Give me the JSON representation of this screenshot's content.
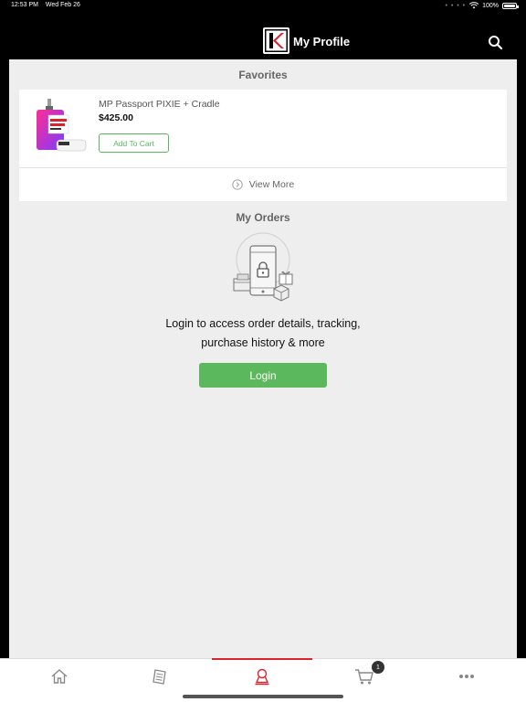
{
  "status_bar": {
    "time": "12:53 PM",
    "date": "Wed Feb 26",
    "battery": "100%"
  },
  "nav": {
    "title": "My Profile",
    "icons": {
      "logo": "brand-logo",
      "search": "search-icon"
    }
  },
  "favorites": {
    "title": "Favorites",
    "item": {
      "name": "MP Passport PIXIE + Cradle",
      "price": "$425.00",
      "add_to_cart": "Add To Cart"
    },
    "view_more": "View More"
  },
  "orders": {
    "title": "My Orders",
    "message_line1": "Login to access order details, tracking,",
    "message_line2": "purchase history & more",
    "login_button": "Login"
  },
  "tab_bar": {
    "tabs": [
      {
        "name": "home",
        "icon": "home-icon"
      },
      {
        "name": "catalog",
        "icon": "catalog-icon"
      },
      {
        "name": "profile",
        "icon": "profile-icon",
        "active": true
      },
      {
        "name": "cart",
        "icon": "cart-icon",
        "badge": "1"
      },
      {
        "name": "more",
        "icon": "more-icon"
      }
    ]
  },
  "colors": {
    "accent": "#d9232e",
    "success": "#5cb85c",
    "background": "#eeeeee",
    "header": "#000000"
  }
}
